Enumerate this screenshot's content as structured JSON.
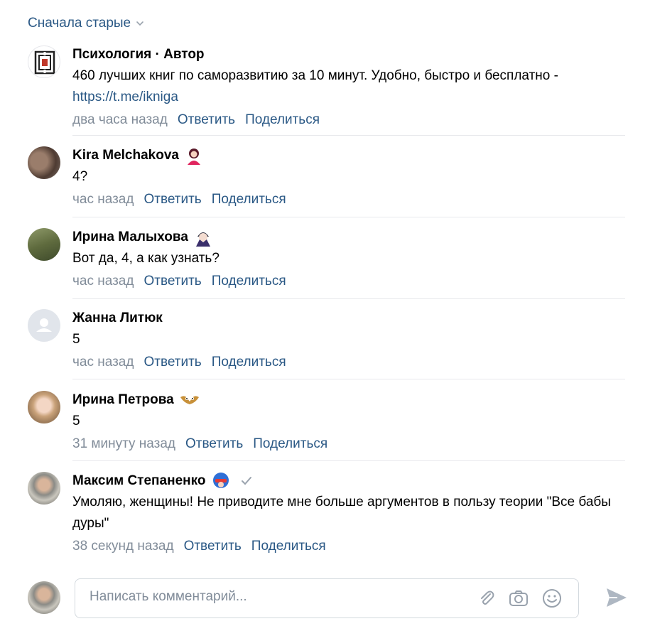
{
  "sort": {
    "label": "Сначала старые"
  },
  "comments": [
    {
      "author": "Психология · Автор",
      "text": "460 лучших книг по саморазвитию за 10 минут. Удобно, быстро и бесплатно - ",
      "link": "https://t.me/ikniga",
      "time": "два часа назад",
      "reply": "Ответить",
      "share": "Поделиться"
    },
    {
      "author": "Kira Melchakova",
      "text": "4?",
      "time": "час назад",
      "reply": "Ответить",
      "share": "Поделиться"
    },
    {
      "author": "Ирина Малыхова",
      "text": "Вот да, 4, а как узнать?",
      "time": "час назад",
      "reply": "Ответить",
      "share": "Поделиться"
    },
    {
      "author": "Жанна Литюк",
      "text": "5",
      "time": "час назад",
      "reply": "Ответить",
      "share": "Поделиться"
    },
    {
      "author": "Ирина Петрова",
      "text": "5",
      "time": "31 минуту назад",
      "reply": "Ответить",
      "share": "Поделиться"
    },
    {
      "author": "Максим Степаненко",
      "text": "Умоляю, женщины! Не приводите мне больше аргументов в пользу теории \"Все бабы дуры\"",
      "time": "38 секунд назад",
      "reply": "Ответить",
      "share": "Поделиться"
    }
  ],
  "composer": {
    "placeholder": "Написать комментарий...",
    "icons": [
      "paperclip-icon",
      "camera-icon",
      "smile-icon",
      "send-icon"
    ]
  },
  "colors": {
    "link": "#2a5885",
    "meta": "#818c99",
    "separator": "#e7e8ec"
  }
}
